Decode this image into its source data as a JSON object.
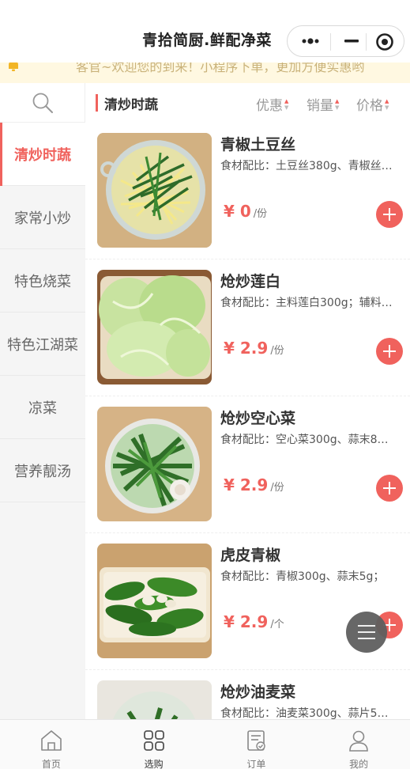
{
  "header": {
    "title": "青拾简厨.鲜配净菜",
    "capsule_icons": [
      "more-dots-icon",
      "minimize-icon",
      "close-target-icon"
    ]
  },
  "notice": {
    "icon": "bell-icon",
    "text": "客官~欢迎您的到来！小程序下单，更加方便实惠哟"
  },
  "sidebar": {
    "search_icon": "search-icon",
    "categories": [
      {
        "label": "清炒时蔬",
        "active": true
      },
      {
        "label": "家常小炒",
        "active": false
      },
      {
        "label": "特色烧菜",
        "active": false
      },
      {
        "label": "特色江湖菜",
        "active": false
      },
      {
        "label": "凉菜",
        "active": false
      },
      {
        "label": "营养靓汤",
        "active": false
      }
    ]
  },
  "sortbar": {
    "section_title": "清炒时蔬",
    "sorts": [
      "优惠",
      "销量",
      "价格"
    ]
  },
  "products": [
    {
      "name": "青椒土豆丝",
      "desc": "食材配比：土豆丝380g、青椒丝…",
      "price": "¥ 0",
      "unit": "/份"
    },
    {
      "name": "炝炒莲白",
      "desc": "食材配比：主料莲白300g；辅料…",
      "price": "¥ 2.9",
      "unit": "/份"
    },
    {
      "name": "炝炒空心菜",
      "desc": "食材配比：空心菜300g、蒜末8…",
      "price": "¥ 2.9",
      "unit": "/份"
    },
    {
      "name": "虎皮青椒",
      "desc": "食材配比：青椒300g、蒜末5g；",
      "price": "¥ 2.9",
      "unit": "/个"
    },
    {
      "name": "炝炒油麦菜",
      "desc": "食材配比：油麦菜300g、蒜片5…",
      "price": "",
      "unit": ""
    }
  ],
  "tabbar": {
    "tabs": [
      {
        "label": "首页",
        "icon": "home-icon"
      },
      {
        "label": "选购",
        "icon": "grid-icon"
      },
      {
        "label": "订单",
        "icon": "order-icon"
      },
      {
        "label": "我的",
        "icon": "user-icon"
      }
    ]
  },
  "colors": {
    "accent": "#f0625d",
    "notice_bg": "#fff8e1",
    "sidebar_bg": "#f5f5f5"
  }
}
